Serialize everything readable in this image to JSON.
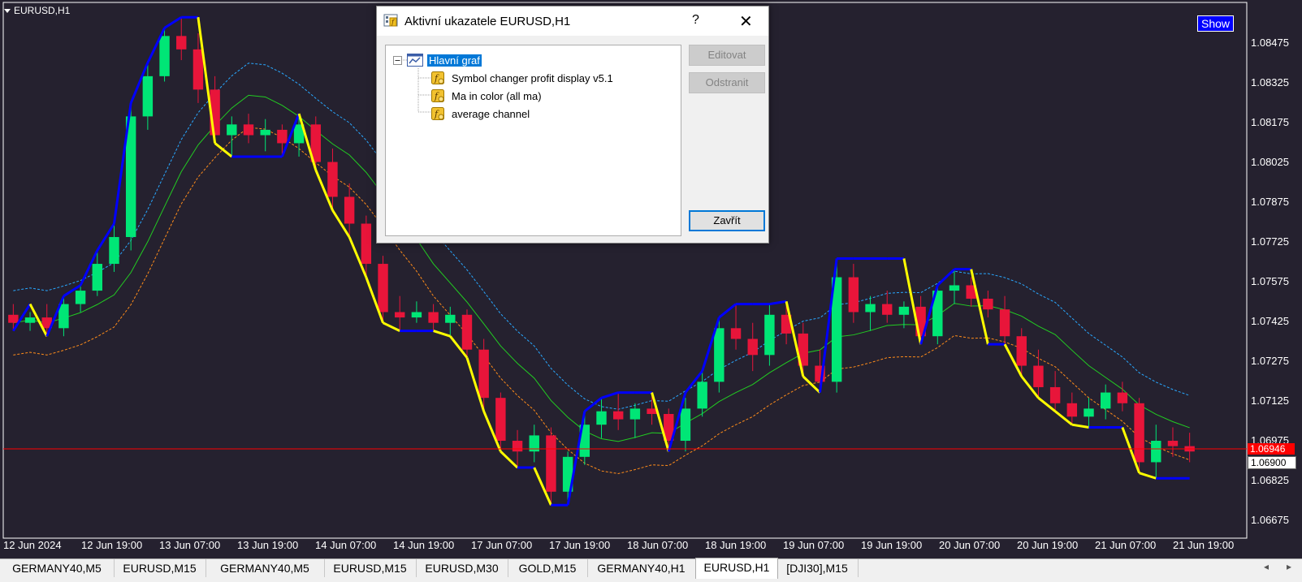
{
  "chart": {
    "symbol": "EURUSD,H1",
    "show_button": "Show",
    "y_axis": [
      "1.08475",
      "1.08325",
      "1.08175",
      "1.08025",
      "1.07875",
      "1.07725",
      "1.07575",
      "1.07425",
      "1.07275",
      "1.07125",
      "1.06975",
      "1.06825",
      "1.06675"
    ],
    "x_axis": [
      "12 Jun 2024",
      "12 Jun 19:00",
      "13 Jun 07:00",
      "13 Jun 19:00",
      "14 Jun 07:00",
      "14 Jun 19:00",
      "17 Jun 07:00",
      "17 Jun 19:00",
      "18 Jun 07:00",
      "18 Jun 19:00",
      "19 Jun 07:00",
      "19 Jun 19:00",
      "20 Jun 07:00",
      "20 Jun 19:00",
      "21 Jun 07:00",
      "21 Jun 19:00"
    ],
    "price_tag_ask": "1.06946",
    "price_tag_bid": "1.06900"
  },
  "chart_data": {
    "type": "candlestick",
    "colors": {
      "bull": "#00e676",
      "bear": "#e8153a",
      "trend_up": "#0000ff",
      "trend_down": "#ffff00",
      "ma_upper": "#29a8ff",
      "ma_mid": "#22cc22",
      "ma_lower": "#ff8c1a",
      "price_line": "#ff0000"
    },
    "ylim": [
      1.0661,
      1.0856
    ],
    "current_price": 1.06946,
    "candles_approx": [
      [
        1.0741,
        1.0745,
        1.0735,
        1.0738
      ],
      [
        1.0738,
        1.0742,
        1.0735,
        1.074
      ],
      [
        1.074,
        1.0745,
        1.0733,
        1.0736
      ],
      [
        1.0736,
        1.0748,
        1.0733,
        1.0745
      ],
      [
        1.0745,
        1.0752,
        1.0742,
        1.075
      ],
      [
        1.075,
        1.0765,
        1.0748,
        1.076
      ],
      [
        1.076,
        1.0775,
        1.0757,
        1.077
      ],
      [
        1.077,
        1.082,
        1.0765,
        1.0815
      ],
      [
        1.0815,
        1.0835,
        1.081,
        1.083
      ],
      [
        1.083,
        1.0848,
        1.0828,
        1.0845
      ],
      [
        1.0845,
        1.0852,
        1.0836,
        1.084
      ],
      [
        1.084,
        1.0846,
        1.082,
        1.0825
      ],
      [
        1.0825,
        1.083,
        1.0805,
        1.0808
      ],
      [
        1.0808,
        1.0815,
        1.08,
        1.0812
      ],
      [
        1.0812,
        1.0816,
        1.0805,
        1.0808
      ],
      [
        1.0808,
        1.0814,
        1.0802,
        1.081
      ],
      [
        1.081,
        1.0812,
        1.08,
        1.0805
      ],
      [
        1.0805,
        1.0815,
        1.08,
        1.0812
      ],
      [
        1.0812,
        1.0815,
        1.0795,
        1.0798
      ],
      [
        1.0798,
        1.0803,
        1.078,
        1.0785
      ],
      [
        1.0785,
        1.079,
        1.077,
        1.0775
      ],
      [
        1.0775,
        1.0778,
        1.0755,
        1.076
      ],
      [
        1.076,
        1.0763,
        1.0738,
        1.0742
      ],
      [
        1.0742,
        1.0748,
        1.0735,
        1.074
      ],
      [
        1.074,
        1.0746,
        1.0738,
        1.0742
      ],
      [
        1.0742,
        1.0745,
        1.0735,
        1.0738
      ],
      [
        1.0738,
        1.0744,
        1.0733,
        1.0741
      ],
      [
        1.0741,
        1.0743,
        1.0725,
        1.0728
      ],
      [
        1.0728,
        1.0732,
        1.0705,
        1.071
      ],
      [
        1.071,
        1.0712,
        1.069,
        1.0694
      ],
      [
        1.0694,
        1.0698,
        1.0684,
        1.069
      ],
      [
        1.069,
        1.07,
        1.0686,
        1.0696
      ],
      [
        1.0696,
        1.0699,
        1.067,
        1.0675
      ],
      [
        1.0675,
        1.069,
        1.0672,
        1.0688
      ],
      [
        1.0688,
        1.0705,
        1.0685,
        1.07
      ],
      [
        1.07,
        1.071,
        1.0695,
        1.0705
      ],
      [
        1.0705,
        1.0712,
        1.0698,
        1.0702
      ],
      [
        1.0702,
        1.0708,
        1.0695,
        1.0706
      ],
      [
        1.0706,
        1.0712,
        1.07,
        1.0704
      ],
      [
        1.0704,
        1.0706,
        1.069,
        1.0694
      ],
      [
        1.0694,
        1.071,
        1.069,
        1.0706
      ],
      [
        1.0706,
        1.072,
        1.0703,
        1.0716
      ],
      [
        1.0716,
        1.074,
        1.0712,
        1.0736
      ],
      [
        1.0736,
        1.0745,
        1.0728,
        1.0732
      ],
      [
        1.0732,
        1.0738,
        1.072,
        1.0726
      ],
      [
        1.0726,
        1.0745,
        1.0722,
        1.0741
      ],
      [
        1.0741,
        1.0746,
        1.073,
        1.0734
      ],
      [
        1.0734,
        1.0738,
        1.0718,
        1.0722
      ],
      [
        1.0722,
        1.0728,
        1.0712,
        1.0716
      ],
      [
        1.0716,
        1.0762,
        1.0712,
        1.0755
      ],
      [
        1.0755,
        1.076,
        1.0738,
        1.0742
      ],
      [
        1.0742,
        1.0748,
        1.0735,
        1.0745
      ],
      [
        1.0745,
        1.075,
        1.0738,
        1.0741
      ],
      [
        1.0741,
        1.0746,
        1.0736,
        1.0744
      ],
      [
        1.0744,
        1.0748,
        1.073,
        1.0733
      ],
      [
        1.0733,
        1.0752,
        1.073,
        1.075
      ],
      [
        1.075,
        1.0758,
        1.0745,
        1.0752
      ],
      [
        1.0752,
        1.0755,
        1.0744,
        1.0747
      ],
      [
        1.0747,
        1.075,
        1.074,
        1.0743
      ],
      [
        1.0743,
        1.0748,
        1.073,
        1.0733
      ],
      [
        1.0733,
        1.0736,
        1.0718,
        1.0722
      ],
      [
        1.0722,
        1.0728,
        1.071,
        1.0714
      ],
      [
        1.0714,
        1.072,
        1.0705,
        1.0708
      ],
      [
        1.0708,
        1.0712,
        1.07,
        1.0703
      ],
      [
        1.0703,
        1.071,
        1.0699,
        1.0706
      ],
      [
        1.0706,
        1.0715,
        1.0702,
        1.0712
      ],
      [
        1.0712,
        1.0716,
        1.0705,
        1.0708
      ],
      [
        1.0708,
        1.071,
        1.0682,
        1.0686
      ],
      [
        1.0686,
        1.07,
        1.068,
        1.0694
      ],
      [
        1.0694,
        1.0699,
        1.0688,
        1.0692
      ],
      [
        1.0692,
        1.0697,
        1.0686,
        1.069
      ]
    ]
  },
  "dialog": {
    "title": "Aktivní ukazatele EURUSD,H1",
    "help": "?",
    "close": "✕",
    "root": "Hlavní graf",
    "indicators": [
      "Symbol changer profit display v5.1",
      "Ma in color (all ma)",
      "average channel"
    ],
    "btn_edit": "Editovat",
    "btn_remove": "Odstranit",
    "btn_close": "Zavřít"
  },
  "tabs": {
    "items": [
      "GERMANY40,M5",
      "EURUSD,M15",
      "GERMANY40,M5",
      "EURUSD,M15",
      "EURUSD,M30",
      "GOLD,M15",
      "GERMANY40,H1",
      "EURUSD,H1",
      "[DJI30],M15"
    ],
    "active": 7,
    "scroll_left": "◂",
    "scroll_right": "▸"
  }
}
